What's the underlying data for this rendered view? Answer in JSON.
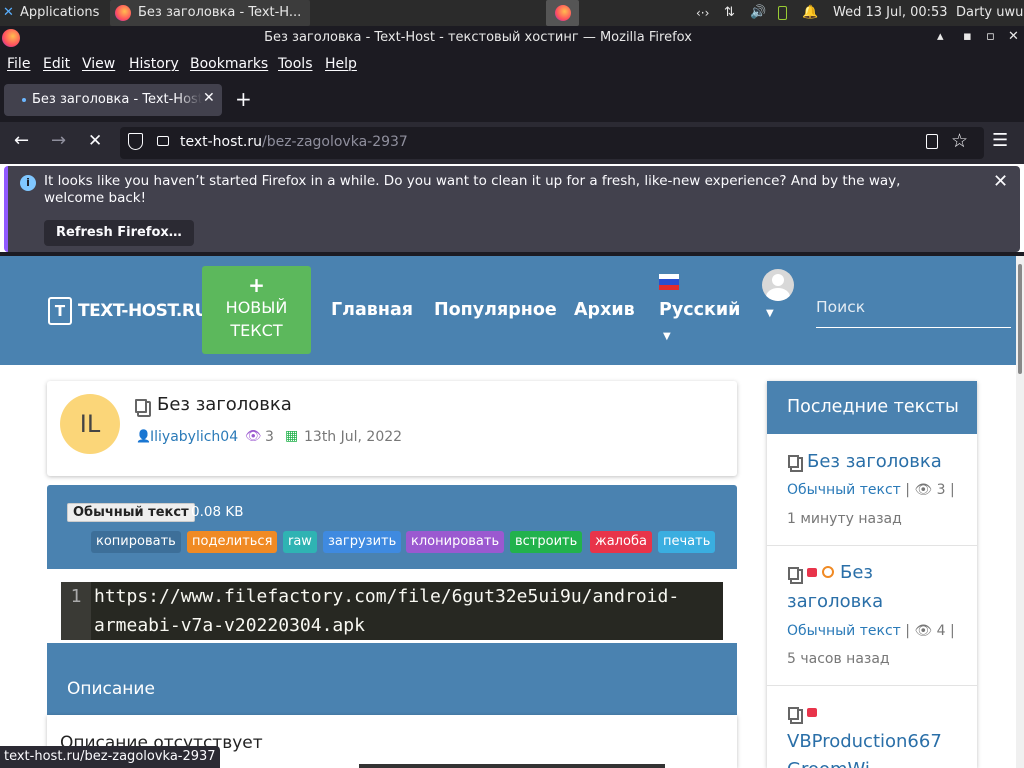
{
  "panel": {
    "applications": "Applications",
    "task_title": "Без заголовка - Text-H...",
    "datetime": "Wed 13 Jul, 00:53",
    "user": "Darty uwu"
  },
  "window": {
    "title": "Без заголовка - Text-Host - текстовый хостинг — Mozilla Firefox"
  },
  "menu": [
    "File",
    "Edit",
    "View",
    "History",
    "Bookmarks",
    "Tools",
    "Help"
  ],
  "tab": {
    "title": "Без заголовка - Text-Host"
  },
  "url": {
    "domain": "text-host.ru",
    "path": "/bez-zagolovka-2937"
  },
  "notification": {
    "message": "It looks like you haven’t started Firefox in a while. Do you want to clean it up for a fresh, like-new experience? And by the way, welcome back!",
    "button": "Refresh Firefox…"
  },
  "site": {
    "logo": "TEXT-HOST.RU",
    "new_text_plus": "+",
    "new_text_l1": "НОВЫЙ",
    "new_text_l2": "ТЕКСТ",
    "nav": [
      "Главная",
      "Популярное",
      "Архив"
    ],
    "language": "Русский",
    "search_placeholder": "Поиск"
  },
  "paste": {
    "avatar": "IL",
    "title": "Без заголовка",
    "author": "Iliyabylich04",
    "views": "3",
    "date": "13th Jul, 2022",
    "type_badge": "Обычный текст",
    "size": "0.08 KB",
    "actions": [
      {
        "label": "копировать",
        "color": "#3d6f99"
      },
      {
        "label": "поделиться",
        "color": "#f08a24"
      },
      {
        "label": "raw",
        "color": "#2fb3b3"
      },
      {
        "label": "загрузить",
        "color": "#3f8ae0"
      },
      {
        "label": "клонировать",
        "color": "#9b59d0"
      },
      {
        "label": "встроить",
        "color": "#22b24c"
      },
      {
        "label": "жалоба",
        "color": "#e8344a"
      },
      {
        "label": "печать",
        "color": "#3aaee0"
      }
    ],
    "line_number": "1",
    "code_l1": "https://www.filefactory.com/file/6gut32e5ui9u/android-",
    "code_l2": "armeabi-v7a-v20220304.apk",
    "desc_header": "Описание",
    "desc_text": "Описание отсутствует"
  },
  "sidebar": {
    "header": "Последние тексты",
    "items": [
      {
        "title": "Без заголовка",
        "type": "Обычный текст",
        "views": "3",
        "time": "1 минуту назад",
        "locked": false
      },
      {
        "title_l1": "Без",
        "title_l2": "заголовка",
        "type": "Обычный текст",
        "views": "4",
        "time": "5 часов назад",
        "locked": true
      },
      {
        "title": "VBProduction667",
        "title_l2": "GroomWi...",
        "locked": true
      }
    ]
  },
  "status_url": "text-host.ru/bez-zagolovka-2937",
  "colors": {
    "firefox_dark": "#1c1b22",
    "site_blue": "#4a82b0",
    "green": "#5cb85c",
    "avatar": "#fbd679"
  }
}
